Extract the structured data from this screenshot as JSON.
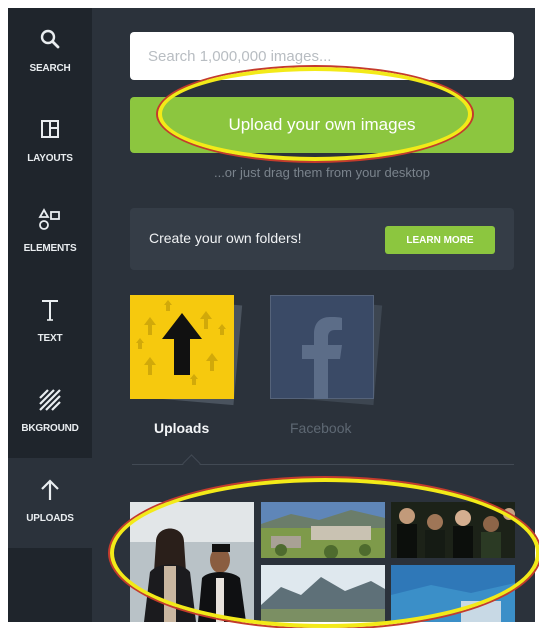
{
  "sidebar": {
    "items": [
      {
        "label": "SEARCH",
        "icon": "search-icon"
      },
      {
        "label": "LAYOUTS",
        "icon": "layouts-icon"
      },
      {
        "label": "ELEMENTS",
        "icon": "elements-icon"
      },
      {
        "label": "TEXT",
        "icon": "text-icon"
      },
      {
        "label": "BKGROUND",
        "icon": "background-icon"
      },
      {
        "label": "UPLOADS",
        "icon": "upload-arrow-icon",
        "active": true
      }
    ]
  },
  "search": {
    "placeholder": "Search 1,000,000 images..."
  },
  "upload": {
    "button_label": "Upload your own images",
    "drag_note": "...or just drag them from your desktop"
  },
  "folders": {
    "text": "Create your own folders!",
    "button_label": "LEARN MORE"
  },
  "sources": [
    {
      "label": "Uploads",
      "active": true
    },
    {
      "label": "Facebook",
      "active": false
    }
  ],
  "colors": {
    "accent": "#8cc63f",
    "sidebar": "#1f252c",
    "panel": "#2b323b",
    "annotation": "#f3ea18"
  }
}
